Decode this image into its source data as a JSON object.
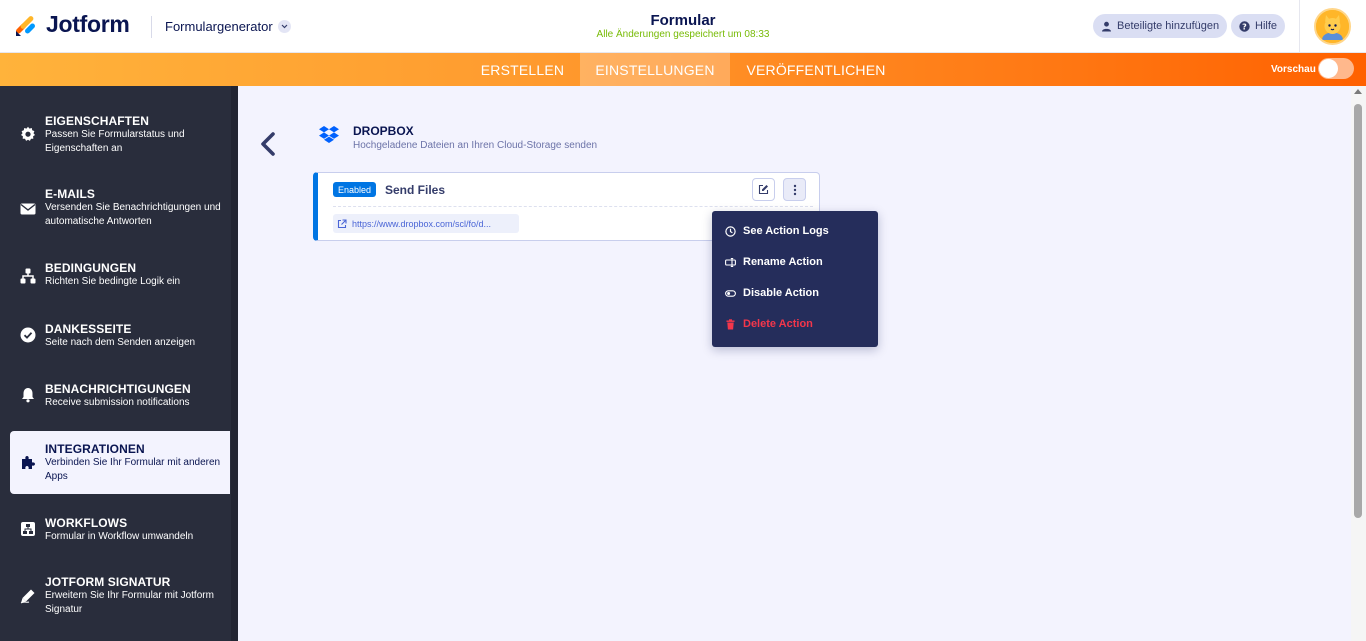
{
  "header": {
    "logo_text": "Jotform",
    "builder_label": "Formulargenerator",
    "form_title": "Formular",
    "save_status": "Alle Änderungen gespeichert um 08:33",
    "add_participants": "Beteiligte hinzufügen",
    "help": "Hilfe"
  },
  "nav": {
    "tabs": [
      {
        "label": "ERSTELLEN"
      },
      {
        "label": "EINSTELLUNGEN"
      },
      {
        "label": "VERÖFFENTLICHEN"
      }
    ],
    "active_tab": "EINSTELLUNGEN",
    "preview_label": "Vorschau"
  },
  "sidebar": {
    "items": [
      {
        "title": "EIGENSCHAFTEN",
        "desc": "Passen Sie Formularstatus und Eigenschaften an",
        "icon": "gear-icon"
      },
      {
        "title": "E-MAILS",
        "desc": "Versenden Sie Benachrichtigungen und automatische Antworten",
        "icon": "envelope-icon"
      },
      {
        "title": "BEDINGUNGEN",
        "desc": "Richten Sie bedingte Logik ein",
        "icon": "logic-icon"
      },
      {
        "title": "DANKESSEITE",
        "desc": "Seite nach dem Senden anzeigen",
        "icon": "check-circle-icon"
      },
      {
        "title": "BENACHRICHTIGUNGEN",
        "desc": "Receive submission notifications",
        "icon": "bell-icon"
      },
      {
        "title": "INTEGRATIONEN",
        "desc": "Verbinden Sie Ihr Formular mit anderen Apps",
        "icon": "puzzle-icon"
      },
      {
        "title": "WORKFLOWS",
        "desc": "Formular in Workflow umwandeln",
        "icon": "workflow-icon"
      },
      {
        "title": "JOTFORM SIGNATUR",
        "desc": "Erweitern Sie Ihr Formular mit Jotform Signatur",
        "icon": "pen-icon"
      }
    ],
    "active_item": "INTEGRATIONEN"
  },
  "integration": {
    "name": "DROPBOX",
    "description": "Hochgeladene Dateien an Ihren Cloud-Storage senden"
  },
  "action_card": {
    "badge": "Enabled",
    "title": "Send Files",
    "link": "https://www.dropbox.com/scl/fo/d..."
  },
  "action_menu": {
    "items": [
      {
        "label": "See Action Logs",
        "icon": "clock-icon"
      },
      {
        "label": "Rename Action",
        "icon": "rename-icon"
      },
      {
        "label": "Disable Action",
        "icon": "toggle-off-icon"
      },
      {
        "label": "Delete Action",
        "icon": "trash-icon"
      }
    ]
  },
  "colors": {
    "brand_dark": "#0a1551",
    "accent_orange": "#ff7a15",
    "sidebar_bg": "#292d3c",
    "enabled_blue": "#0075e3",
    "save_green": "#78bb07",
    "danger_red": "#f3364b"
  }
}
